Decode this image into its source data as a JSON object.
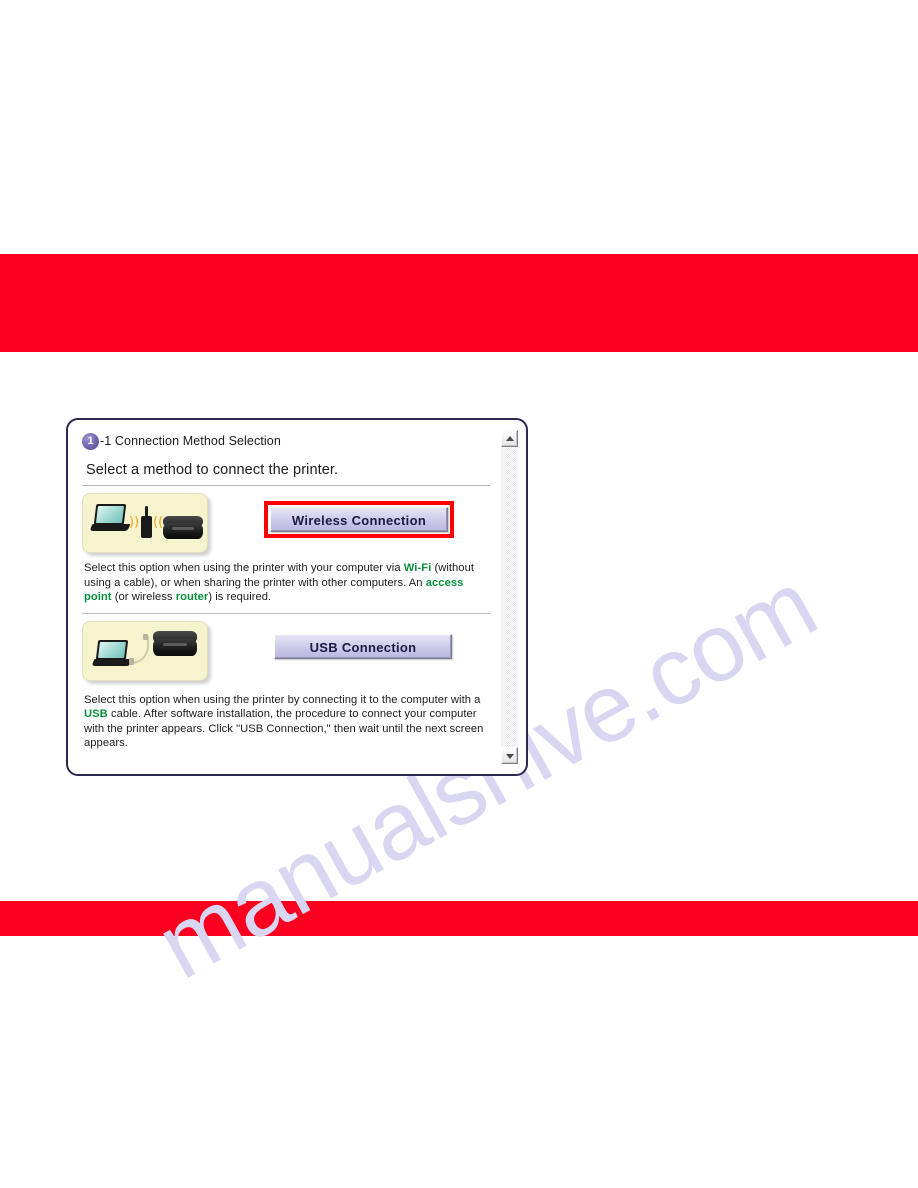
{
  "page": {
    "background_color": "#ffffff",
    "watermark_text": "manualshive.com",
    "watermark_color": "#d9d6f2"
  },
  "bands": {
    "accent_color": "#f90020",
    "top": {
      "label": ""
    },
    "bottom": {
      "label": ""
    }
  },
  "dialog": {
    "border_color": "#2b2a4e",
    "step_badge": "1",
    "step_title": "-1 Connection Method Selection",
    "lead": "Select a method to connect the printer.",
    "options": [
      {
        "id": "wireless",
        "button_label": "Wireless Connection",
        "highlighted": true,
        "highlight_color": "#ff0000",
        "thumbnail_name": "wireless-setup-illustration",
        "description_parts": [
          {
            "text": "Select this option when using the printer with your computer via ",
            "emphasis": false
          },
          {
            "text": "Wi-Fi",
            "emphasis": true
          },
          {
            "text": " (without using a cable), or when sharing the printer with other computers. An ",
            "emphasis": false
          },
          {
            "text": "access point",
            "emphasis": true
          },
          {
            "text": " (or wireless ",
            "emphasis": false
          },
          {
            "text": "router",
            "emphasis": true
          },
          {
            "text": ") is required.",
            "emphasis": false
          }
        ]
      },
      {
        "id": "usb",
        "button_label": "USB Connection",
        "highlighted": false,
        "thumbnail_name": "usb-setup-illustration",
        "description_parts": [
          {
            "text": "Select this option when using the printer by connecting it to the computer with a ",
            "emphasis": false
          },
          {
            "text": "USB",
            "emphasis": true
          },
          {
            "text": " cable. After software installation, the procedure to connect your computer with the printer appears. Click \"USB Connection,\" then wait until the next screen appears.",
            "emphasis": false
          }
        ]
      }
    ],
    "scrollbar": {
      "up_arrow": "scroll-up",
      "down_arrow": "scroll-down"
    },
    "emphasis_color": "#0a8f3c",
    "button_text_color": "#1b1b42"
  }
}
